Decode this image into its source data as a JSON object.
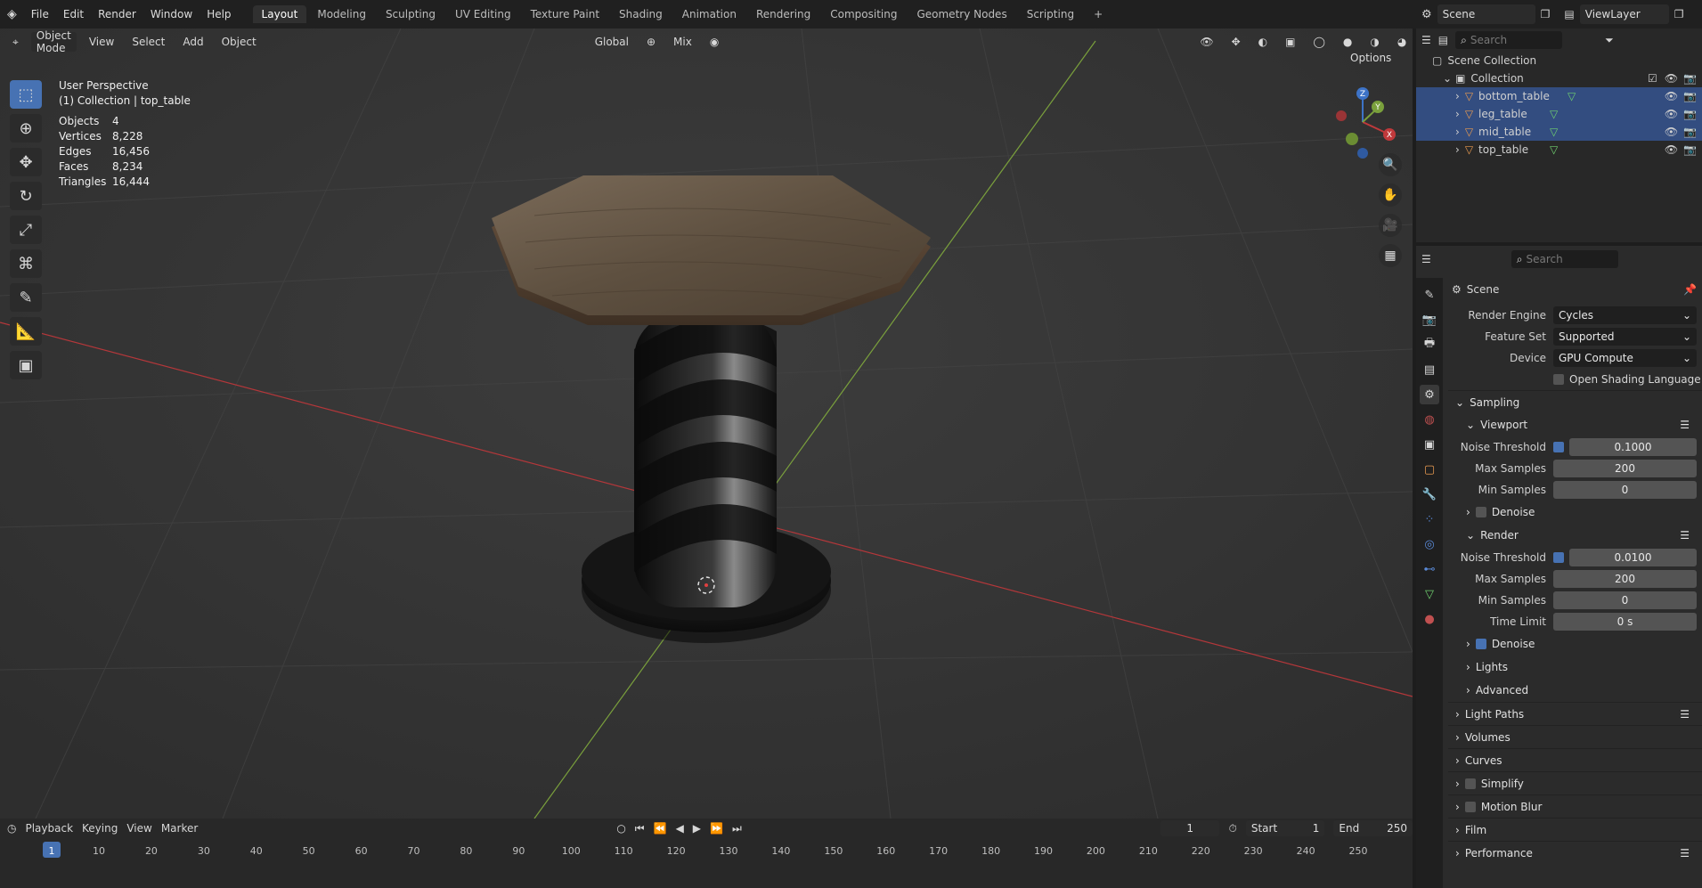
{
  "topbar": {
    "menus": [
      "File",
      "Edit",
      "Render",
      "Window",
      "Help"
    ],
    "workspaces": [
      "Layout",
      "Modeling",
      "Sculpting",
      "UV Editing",
      "Texture Paint",
      "Shading",
      "Animation",
      "Rendering",
      "Compositing",
      "Geometry Nodes",
      "Scripting"
    ],
    "active_workspace": "Layout",
    "add_tab": "+",
    "scene": "Scene",
    "view_layer": "ViewLayer"
  },
  "viewport": {
    "mode": "Object Mode",
    "menus": [
      "View",
      "Select",
      "Add",
      "Object"
    ],
    "transform": "Global",
    "snapping": "Mix",
    "options": "Options",
    "perspective": "User Perspective",
    "collection_info": "(1) Collection | top_table",
    "stats": [
      {
        "label": "Objects",
        "value": "4"
      },
      {
        "label": "Vertices",
        "value": "8,228"
      },
      {
        "label": "Edges",
        "value": "16,456"
      },
      {
        "label": "Faces",
        "value": "8,234"
      },
      {
        "label": "Triangles",
        "value": "16,444"
      }
    ],
    "gizmo": {
      "x": "X",
      "y": "Y",
      "z": "Z"
    }
  },
  "outliner": {
    "search_placeholder": "Search",
    "root": "Scene Collection",
    "collection": "Collection",
    "items": [
      {
        "name": "bottom_table",
        "selected": true
      },
      {
        "name": "leg_table",
        "selected": true
      },
      {
        "name": "mid_table",
        "selected": true
      },
      {
        "name": "top_table",
        "selected": false
      }
    ]
  },
  "properties": {
    "search_placeholder": "Search",
    "context": "Scene",
    "render_engine_label": "Render Engine",
    "render_engine": "Cycles",
    "feature_set_label": "Feature Set",
    "feature_set": "Supported",
    "device_label": "Device",
    "device": "GPU Compute",
    "osl_label": "Open Shading Language",
    "sampling": "Sampling",
    "viewport_section": "Viewport",
    "render_section": "Render",
    "noise_threshold_label": "Noise Threshold",
    "max_samples_label": "Max Samples",
    "min_samples_label": "Min Samples",
    "time_limit_label": "Time Limit",
    "denoise_label": "Denoise",
    "vp_noise": "0.1000",
    "vp_max": "200",
    "vp_min": "0",
    "r_noise": "0.0100",
    "r_max": "200",
    "r_min": "0",
    "r_time": "0 s",
    "lights": "Lights",
    "advanced": "Advanced",
    "panels": [
      "Light Paths",
      "Volumes",
      "Curves",
      "Simplify",
      "Motion Blur",
      "Film",
      "Performance"
    ]
  },
  "timeline": {
    "menus": [
      "Playback",
      "Keying",
      "View",
      "Marker"
    ],
    "current_frame": "1",
    "start_label": "Start",
    "start": "1",
    "end_label": "End",
    "end": "250",
    "ticks": [
      "1",
      "10",
      "20",
      "30",
      "40",
      "50",
      "60",
      "70",
      "80",
      "90",
      "100",
      "110",
      "120",
      "130",
      "140",
      "150",
      "160",
      "170",
      "180",
      "190",
      "200",
      "210",
      "220",
      "230",
      "240",
      "250"
    ]
  },
  "colors": {
    "accent": "#4772b3",
    "selected_row": "#334d80",
    "x_axis": "#c0393b",
    "y_axis": "#7aa03c",
    "z_axis": "#3d73c7"
  }
}
